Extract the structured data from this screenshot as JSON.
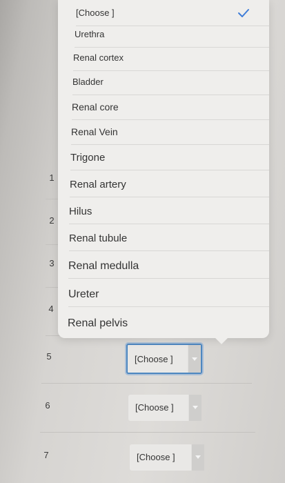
{
  "dropdown": {
    "options": [
      "[Choose ]",
      "Urethra",
      "Renal cortex",
      "Bladder",
      "Renal core",
      "Renal Vein",
      "Trigone",
      "Renal artery",
      "Hilus",
      "Renal tubule",
      "Renal medulla",
      "Ureter",
      "Renal pelvis"
    ],
    "selected_index": 0,
    "check_icon": "checkmark-icon",
    "accent_color": "#3e7cd8"
  },
  "questions": [
    {
      "number": "1"
    },
    {
      "number": "2"
    },
    {
      "number": "3"
    },
    {
      "number": "4"
    },
    {
      "number": "5",
      "selected": "[Choose ]"
    },
    {
      "number": "6",
      "selected": "[Choose ]"
    },
    {
      "number": "7",
      "selected": "[Choose ]"
    }
  ]
}
